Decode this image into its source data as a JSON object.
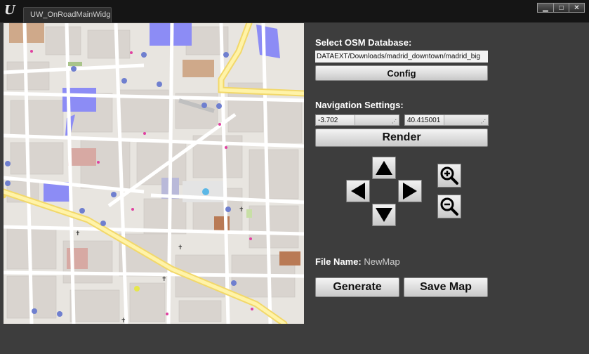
{
  "window": {
    "tab_title": "UW_OnRoadMainWidg",
    "minimize_glyph": "▁",
    "maximize_glyph": "□",
    "close_glyph": "✕"
  },
  "osm": {
    "label": "Select OSM Database:",
    "path_value": "DATAEXT/Downloads/madrid_downtown/madrid_big",
    "config_label": "Config"
  },
  "navigation": {
    "label": "Navigation Settings:",
    "longitude": "-3.702",
    "latitude": "40.415001",
    "render_label": "Render"
  },
  "file": {
    "label": "File Name:",
    "value": "NewMap"
  },
  "actions": {
    "generate_label": "Generate",
    "save_label": "Save Map"
  },
  "icons": {
    "app_logo": "unreal-logo-icon",
    "up": "arrow-up-icon",
    "left": "arrow-left-icon",
    "right": "arrow-right-icon",
    "down": "arrow-down-icon",
    "zoom_in": "zoom-in-icon",
    "zoom_out": "zoom-out-icon"
  },
  "colors": {
    "background": "#3d3d3d",
    "titlebar": "#151515",
    "map_base": "#e8e5e0",
    "road_major": "#f7e37a",
    "building": "#d9d0c9",
    "blue_area": "#8c8cf5"
  }
}
